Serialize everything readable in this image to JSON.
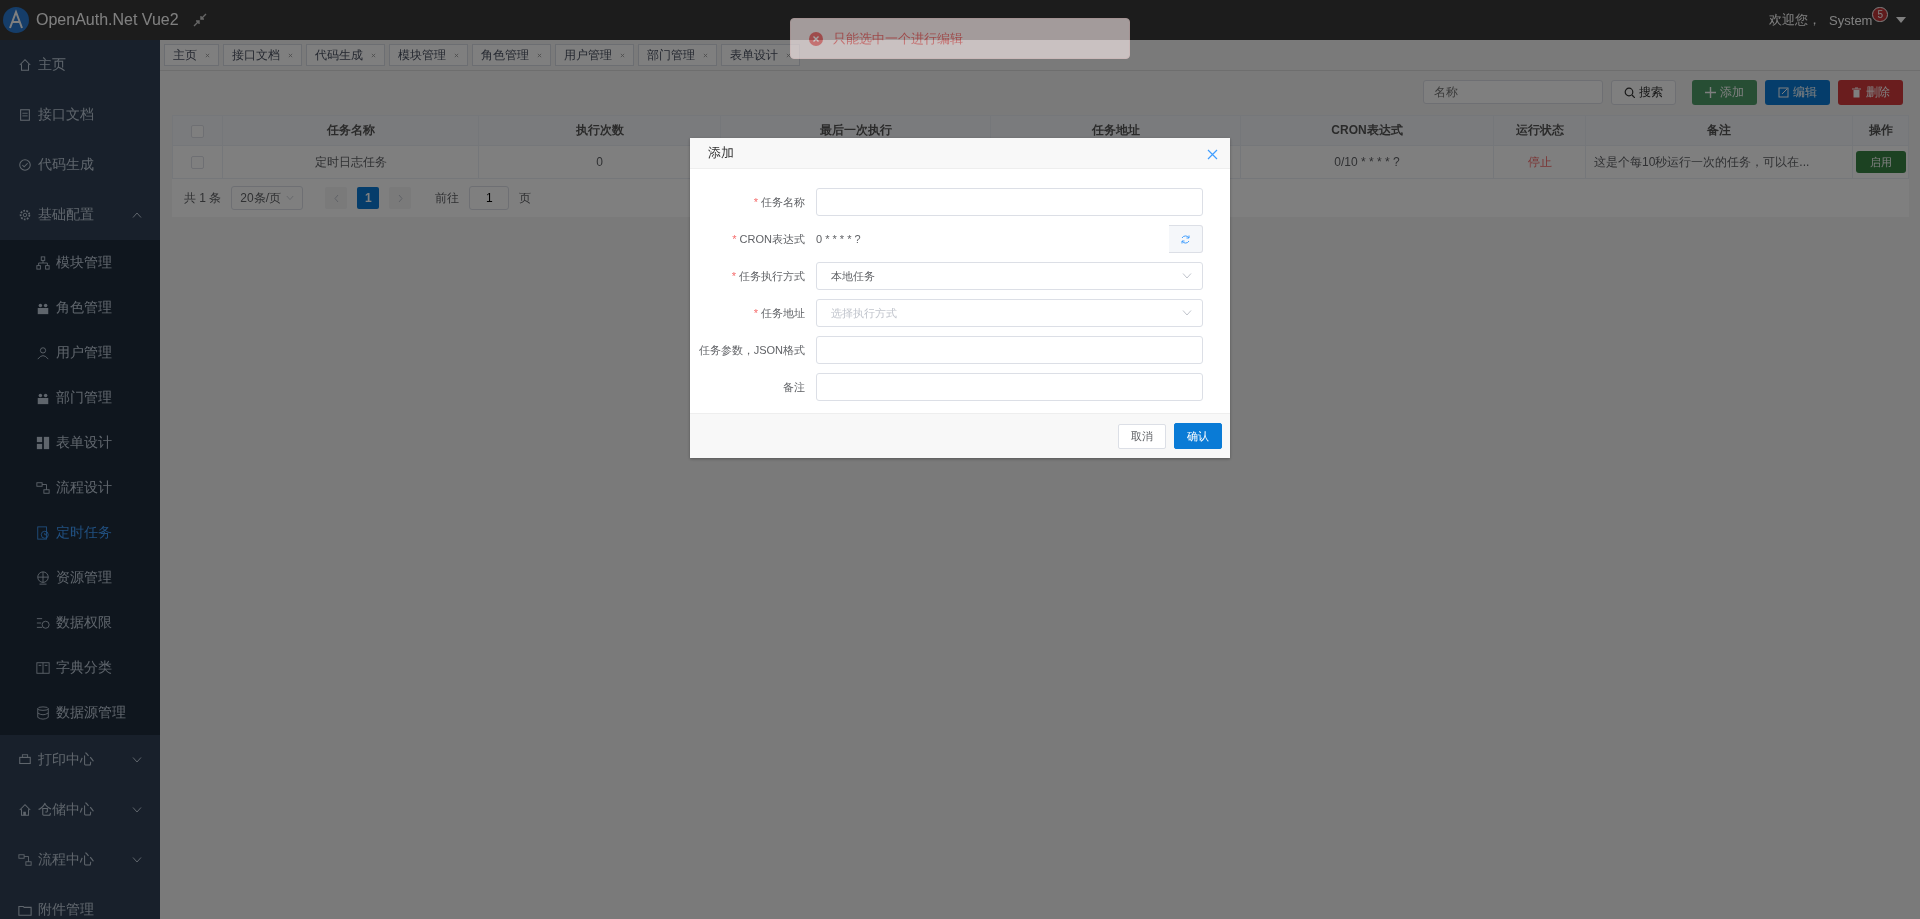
{
  "header": {
    "title": "OpenAuth.Net Vue2",
    "welcome": "欢迎您，",
    "user": "System",
    "badge": "5"
  },
  "toast": {
    "kind": "error",
    "message": "只能选中一个进行编辑"
  },
  "sidebar": {
    "items": [
      {
        "kind": "link",
        "label": "主页",
        "selected": false
      },
      {
        "kind": "link",
        "label": "接口文档",
        "selected": false
      },
      {
        "kind": "link",
        "label": "代码生成",
        "selected": false
      },
      {
        "kind": "group",
        "label": "基础配置",
        "selected": false,
        "expanded": true,
        "children": [
          {
            "label": "模块管理",
            "selected": false
          },
          {
            "label": "角色管理",
            "selected": false
          },
          {
            "label": "用户管理",
            "selected": false
          },
          {
            "label": "部门管理",
            "selected": false
          },
          {
            "label": "表单设计",
            "selected": false
          },
          {
            "label": "流程设计",
            "selected": false
          },
          {
            "label": "定时任务",
            "selected": true
          },
          {
            "label": "资源管理",
            "selected": false
          },
          {
            "label": "数据权限",
            "selected": false
          },
          {
            "label": "字典分类",
            "selected": false
          },
          {
            "label": "数据源管理",
            "selected": false
          }
        ]
      },
      {
        "kind": "group",
        "label": "打印中心",
        "selected": false,
        "expanded": false
      },
      {
        "kind": "group",
        "label": "仓储中心",
        "selected": false,
        "expanded": false
      },
      {
        "kind": "group",
        "label": "流程中心",
        "selected": false,
        "expanded": false
      },
      {
        "kind": "link",
        "label": "附件管理",
        "selected": false
      }
    ]
  },
  "tabs": [
    {
      "label": "主页",
      "selected": false
    },
    {
      "label": "接口文档",
      "selected": false
    },
    {
      "label": "代码生成",
      "selected": false
    },
    {
      "label": "模块管理",
      "selected": false
    },
    {
      "label": "角色管理",
      "selected": false
    },
    {
      "label": "用户管理",
      "selected": false
    },
    {
      "label": "部门管理",
      "selected": false
    },
    {
      "label": "表单设计",
      "selected": false
    }
  ],
  "toolbar": {
    "search_placeholder": "名称",
    "buttons": [
      {
        "kind": "search",
        "label": "搜索"
      },
      {
        "kind": "add",
        "label": "添加"
      },
      {
        "kind": "edit",
        "label": "编辑"
      },
      {
        "kind": "delete",
        "label": "删除"
      }
    ]
  },
  "table": {
    "select_all": false,
    "columns": [
      "任务名称",
      "执行次数",
      "最后一次执行",
      "任务地址",
      "CRON表达式",
      "运行状态",
      "备注",
      "操作"
    ],
    "rows": [
      {
        "checked": false,
        "cells": [
          "定时日志任务",
          "0",
          null,
          null,
          "0/10 * * * * ?"
        ],
        "status": "停止",
        "running": false,
        "note": "这是个每10秒运行一次的任务，可以在...",
        "action": "启用"
      }
    ]
  },
  "pagination": {
    "total": "共 1 条",
    "page_size": "20条/页",
    "pages": [
      {
        "label": "1",
        "selected": true
      }
    ],
    "goto_label": "前往",
    "goto_value": "1",
    "goto_suffix": "页"
  },
  "dialog": {
    "title": "添加",
    "fields": [
      {
        "kind": "text",
        "label": "任务名称",
        "required_mark": "*"
      },
      {
        "kind": "cron",
        "label": "CRON表达式",
        "required_mark": "*",
        "value": "0 * * * * ?"
      },
      {
        "kind": "select",
        "label": "任务执行方式",
        "required_mark": "*",
        "value": "本地任务"
      },
      {
        "kind": "select",
        "label": "任务地址",
        "required_mark": "*",
        "placeholder": "选择执行方式"
      },
      {
        "kind": "text",
        "label": "任务参数，JSON格式"
      },
      {
        "kind": "text",
        "label": "备注"
      }
    ],
    "buttons": [
      {
        "kind": "cancel",
        "label": "取消"
      },
      {
        "kind": "confirm",
        "label": "确认"
      }
    ]
  }
}
